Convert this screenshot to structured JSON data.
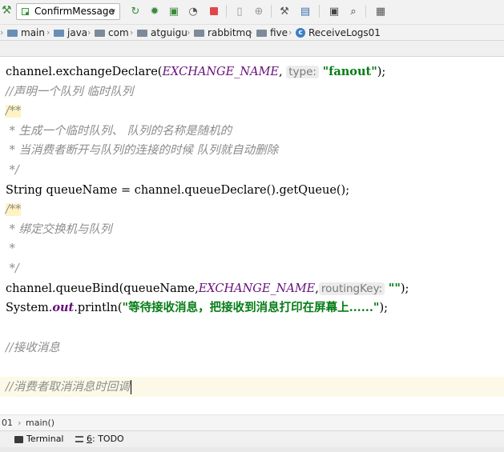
{
  "toolbar": {
    "run_config": "ConfirmMessage",
    "icons": [
      "hammer-icon",
      "rerun-icon",
      "debug-icon",
      "coverage-icon",
      "profile-icon",
      "stop-icon",
      "vcs-icon",
      "attach-icon",
      "settings-icon",
      "project-structure-icon",
      "layout-icon",
      "search-icon",
      "translate-icon"
    ]
  },
  "breadcrumb": {
    "items": [
      "main",
      "java",
      "com",
      "atguigu",
      "rabbitmq",
      "five",
      "ReceiveLogs01"
    ]
  },
  "code": {
    "l1": {
      "a": "channel.exchangeDeclare(",
      "b": "EXCHANGE_NAME",
      "c": ", ",
      "hint": "type:",
      "d": " ",
      "s": "\"fanout\"",
      "e": ");"
    },
    "l2": "//声明一个队列 临时队列",
    "l3": "/**",
    "l4": " * 生成一个临时队列、 队列的名称是随机的",
    "l5": " * 当消费者断开与队列的连接的时候 队列就自动删除",
    "l6": " */",
    "l7": "String queueName = channel.queueDeclare().getQueue();",
    "l8": "/**",
    "l9": " * 绑定交换机与队列",
    "l10": " *",
    "l11": " */",
    "l12": {
      "a": "channel.queueBind(queueName,",
      "b": "EXCHANGE_NAME",
      "c": ",",
      "hint": "routingKey:",
      "d": " ",
      "s": "\"\"",
      "e": ");"
    },
    "l13": {
      "a": "System.",
      "b": "out",
      "c": ".println(",
      "s": "\"等待接收消息，把接收到消息打印在屏幕上......\"",
      "e": ");"
    },
    "l14": "//接收消息",
    "l15": "//消费者取消消息时回调"
  },
  "method_breadcrumb": {
    "left": "01",
    "sep": "›",
    "method": "main()"
  },
  "tool_windows": {
    "terminal": "Terminal",
    "todo_number": "6",
    "todo_label": ": TODO"
  },
  "colors": {
    "accent": "#3b7fc4",
    "string": "#067d17",
    "constant": "#660e7a",
    "comment": "#8c8c8c",
    "current_line": "#fdf9e8"
  }
}
